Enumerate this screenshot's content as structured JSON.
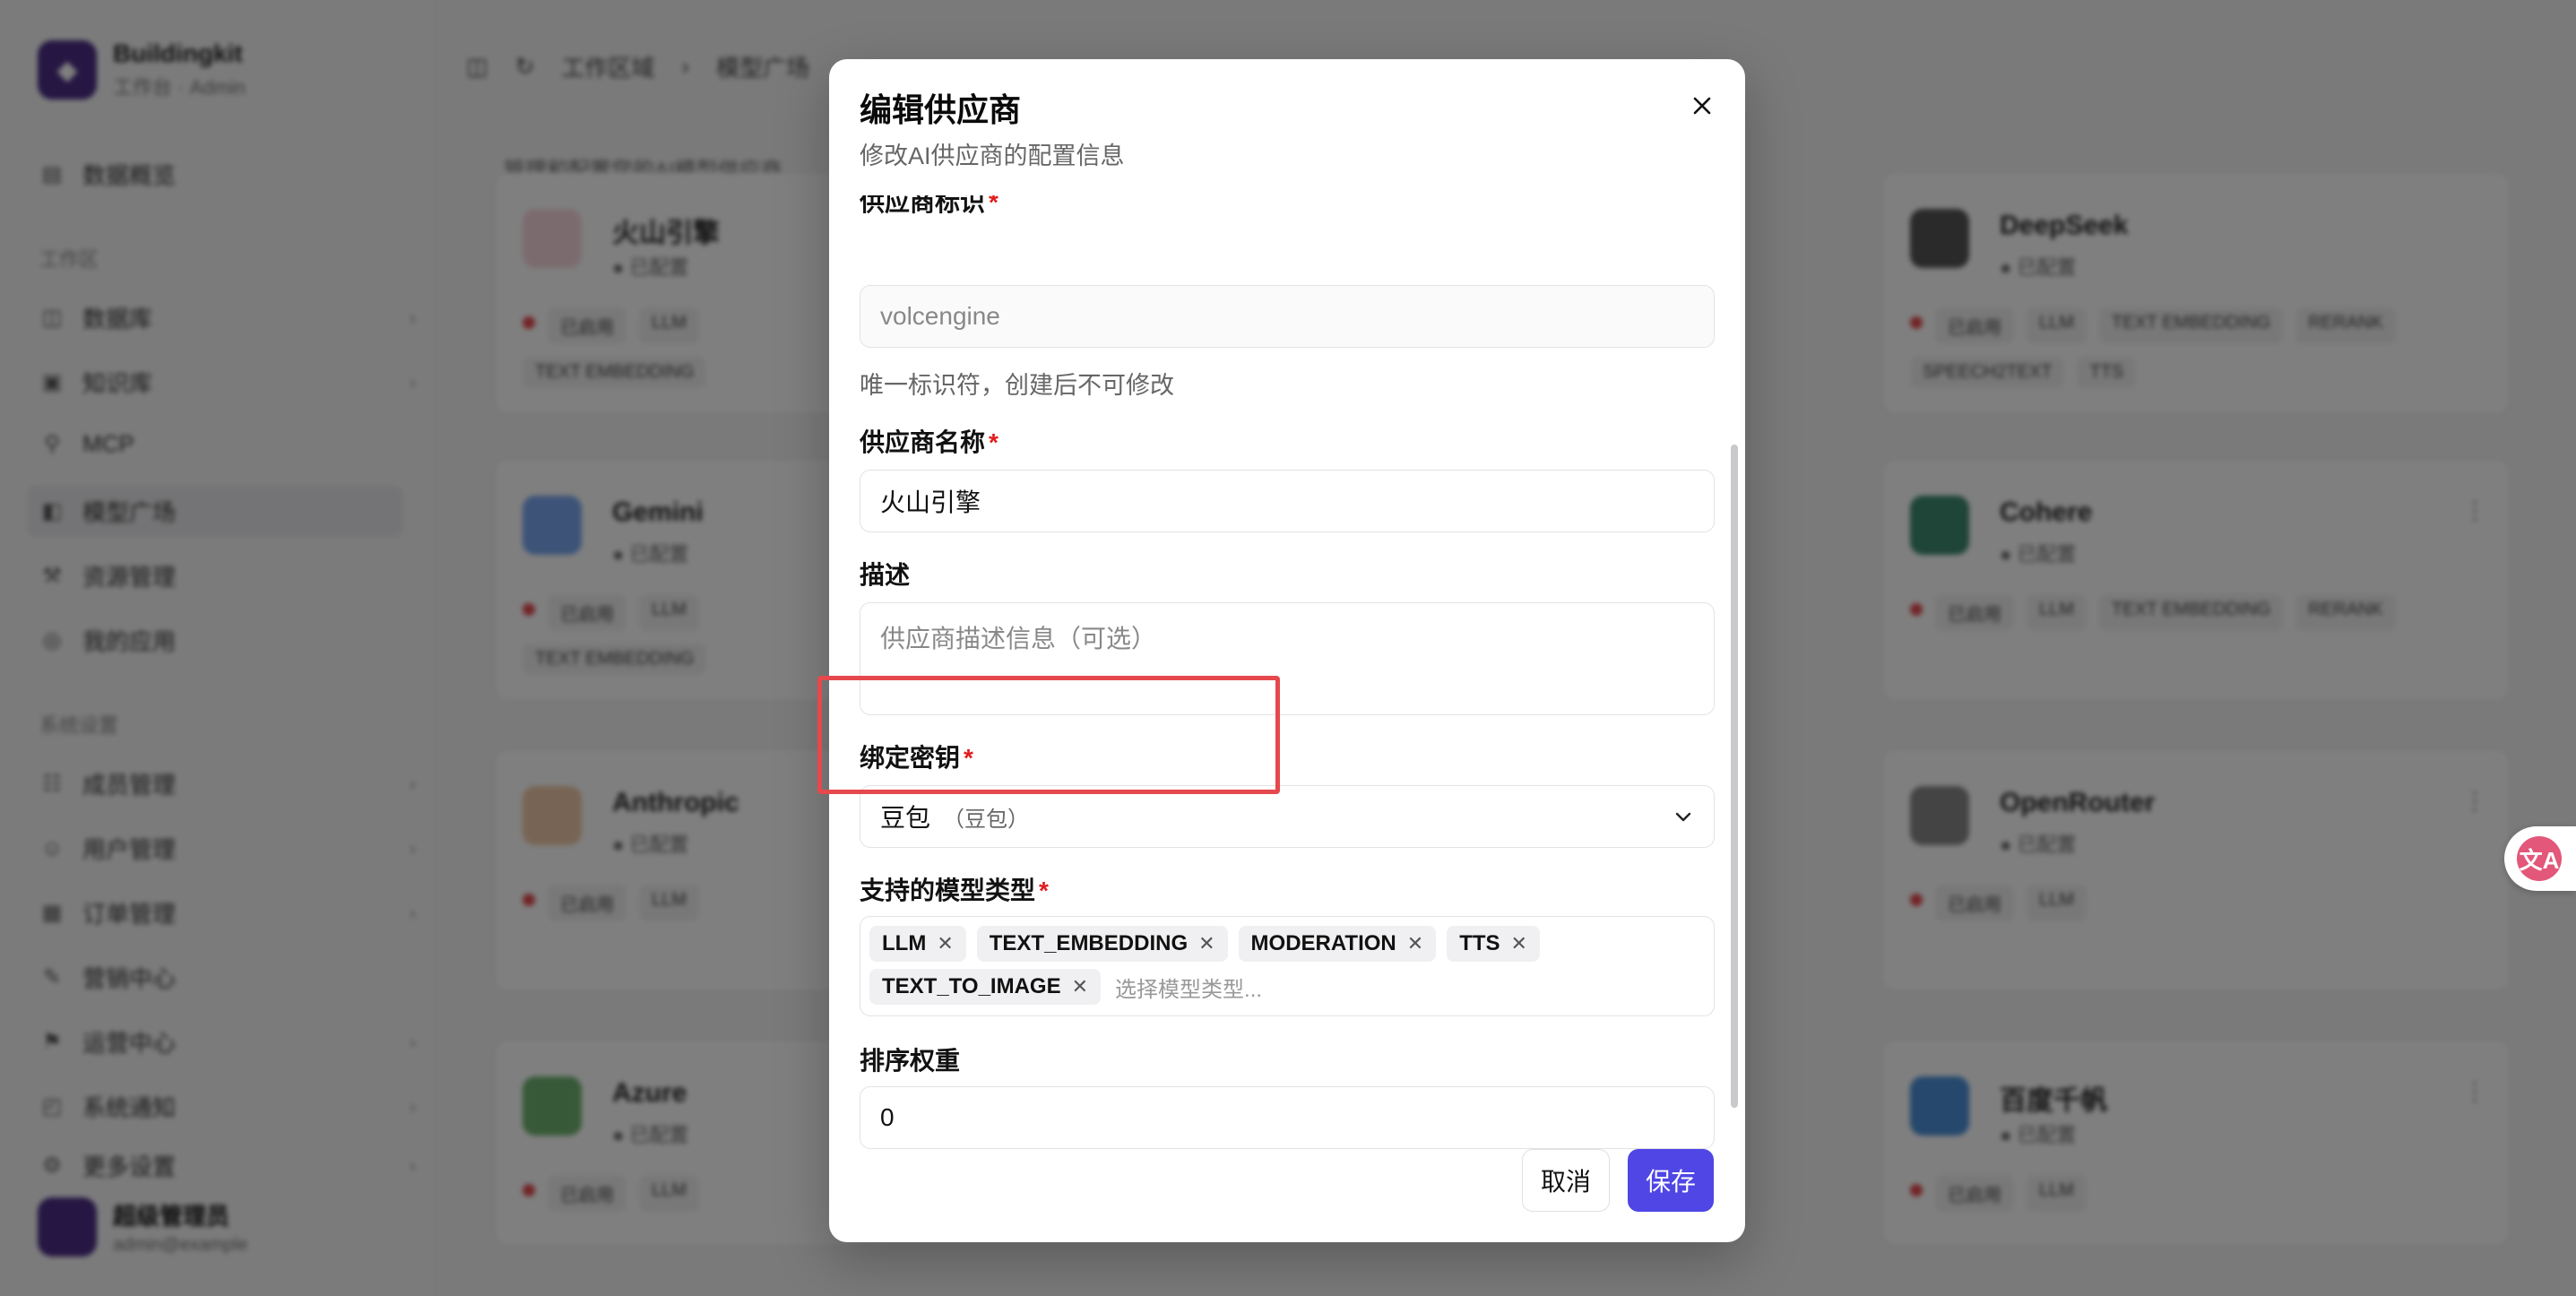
{
  "app": {
    "brand_name": "Buildingkit",
    "brand_sub": "工作台 · Admin",
    "nav": {
      "dashboard": "数据概览",
      "group_workbench": "工作区",
      "knowledge": "数据库",
      "app": "知识库",
      "mcp": "MCP",
      "model_plaza": "模型广场",
      "tools": "资源管理",
      "api_apps": "我的应用",
      "group_system": "系统设置",
      "member": "成员管理",
      "account": "用户管理",
      "channel": "订单管理",
      "billing": "营销中心",
      "dataset": "运营中心",
      "sys_config": "系统通知",
      "more": "更多设置"
    },
    "user_name": "超级管理员",
    "user_mail": "admin@example",
    "breadcrumb": [
      "工作区域",
      "模型广场"
    ],
    "page_subtitle": "管理和配置您的AI模型供应商",
    "cards": [
      {
        "name": "火山引擎",
        "status": "● 已配置",
        "tags": [
          "已启用",
          "LLM",
          "TEXT EMBEDDING"
        ]
      },
      {
        "name": "DeepSeek",
        "status": "● 已配置",
        "tags": [
          "已启用",
          "LLM",
          "TEXT EMBEDDING",
          "RERANK",
          "SPEECH2TEXT",
          "TTS"
        ]
      },
      {
        "name": "Gemini",
        "status": "● 已配置",
        "tags": [
          "已启用",
          "LLM",
          "TEXT EMBEDDING"
        ]
      },
      {
        "name": "Cohere",
        "status": "● 已配置",
        "tags": [
          "已启用",
          "LLM",
          "TEXT EMBEDDING",
          "RERANK"
        ]
      },
      {
        "name": "Anthropic",
        "status": "● 已配置",
        "tags": [
          "已启用",
          "LLM"
        ]
      },
      {
        "name": "OpenRouter",
        "status": "● 已配置",
        "tags": [
          "已启用",
          "LLM"
        ]
      },
      {
        "name": "Azure",
        "status": "● 已配置",
        "tags": [
          "已启用",
          "LLM"
        ]
      },
      {
        "name": "百度千帆",
        "status": "● 已配置",
        "tags": [
          "已启用",
          "LLM"
        ]
      }
    ]
  },
  "modal": {
    "title": "编辑供应商",
    "description": "修改AI供应商的配置信息",
    "fields": {
      "identifier": {
        "label": "供应商标识",
        "value": "volcengine",
        "hint": "唯一标识符，创建后不可修改"
      },
      "name": {
        "label": "供应商名称",
        "value": "火山引擎"
      },
      "description": {
        "label": "描述",
        "placeholder": "供应商描述信息（可选）"
      },
      "secret": {
        "label": "绑定密钥",
        "value": "豆包",
        "value_sub": "（豆包）"
      },
      "model_types": {
        "label": "支持的模型类型",
        "chips": [
          "LLM",
          "TEXT_EMBEDDING",
          "MODERATION",
          "TTS",
          "TEXT_TO_IMAGE"
        ],
        "placeholder": "选择模型类型..."
      },
      "sort_weight": {
        "label": "排序权重",
        "value": "0"
      }
    },
    "required_mark": "*",
    "cancel_label": "取消",
    "save_label": "保存"
  },
  "colors": {
    "primary": "#4f46e5",
    "required": "#e11d1d",
    "highlight": "#e5484d"
  },
  "icons": {
    "close": "close-icon",
    "chevron": "chevron-down-icon",
    "chip_remove": "x-icon",
    "translate": "translate-icon"
  }
}
